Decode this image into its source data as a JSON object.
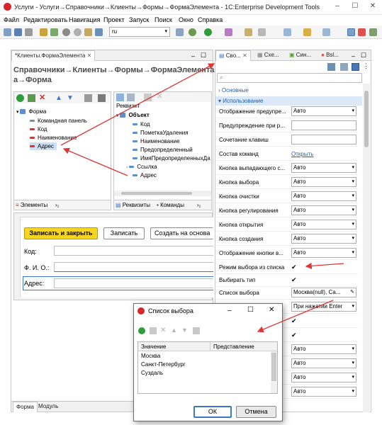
{
  "window": {
    "title": "Услуги - Услуги→Справочники→Клиенты→Формы→ФормаЭлемента - 1C:Enterprise Development Tools"
  },
  "menu": [
    "Файл",
    "Редактировать",
    "Навигация",
    "Проект",
    "Запуск",
    "Поиск",
    "Окно",
    "Справка"
  ],
  "toolbar": {
    "lang": "ru"
  },
  "editor": {
    "tab": "*Клиенты.ФормаЭлемента",
    "heading_line1": "Справочники→Клиенты→Формы→ФормаЭлемента",
    "heading_line2": "а→Форма"
  },
  "elements_tree": {
    "root": "Форма",
    "items": [
      "Командная панель",
      "Код",
      "Наименование",
      "Адрес"
    ],
    "tabs": [
      "Элементы",
      "›₁"
    ]
  },
  "attributes_tree": {
    "header": "Реквизит",
    "root": "Объект",
    "items": [
      "Код",
      "ПометкаУдаления",
      "Наименование",
      "Предопределенный",
      "ИмяПредопределенныхДа",
      "Ссылка",
      "Адрес"
    ],
    "tabs": [
      "Реквизиты",
      "Команды",
      "›₁"
    ]
  },
  "form_preview": {
    "buttons": [
      "Записать и закрыть",
      "Записать",
      "Создать на основа"
    ],
    "fields": [
      "Код:",
      "Ф. И. О.:",
      "Адрес:"
    ]
  },
  "bottom_tabs": [
    "Форма",
    "Модуль"
  ],
  "properties": {
    "tabs": [
      "Сво...",
      "Схе...",
      "Син...",
      "Bsl..."
    ],
    "search_placeholder": "",
    "group_basic": "Основные",
    "group_usage": "Использование",
    "rows": [
      {
        "label": "Отображение предупре...",
        "value": "Авто",
        "type": "select"
      },
      {
        "label": "Предупреждение при р...",
        "value": "",
        "type": "text"
      },
      {
        "label": "Сочетание клавиш",
        "value": "",
        "type": "text"
      },
      {
        "label": "Состав команд",
        "value": "Открыть",
        "type": "link"
      },
      {
        "label": "Кнопка выпадающего с...",
        "value": "Авто",
        "type": "select"
      },
      {
        "label": "Кнопка выбора",
        "value": "Авто",
        "type": "select"
      },
      {
        "label": "Кнопка очистки",
        "value": "Авто",
        "type": "select"
      },
      {
        "label": "Кнопка регулирования",
        "value": "Авто",
        "type": "select"
      },
      {
        "label": "Кнопка открытия",
        "value": "Авто",
        "type": "select"
      },
      {
        "label": "Кнопка создания",
        "value": "Авто",
        "type": "select"
      },
      {
        "label": "Отображение кнопки в...",
        "value": "Авто",
        "type": "select"
      },
      {
        "label": "Режим выбора из списка",
        "value": "✔",
        "type": "check"
      },
      {
        "label": "Выбирать тип",
        "value": "✔",
        "type": "check"
      },
      {
        "label": "Список выбора",
        "value": "Москва(null), Са...",
        "type": "list"
      },
      {
        "label": "",
        "value": "При нажатии Enter",
        "type": "select"
      },
      {
        "label": "",
        "value": "✔",
        "type": "check"
      },
      {
        "label": "",
        "value": "✔",
        "type": "check"
      },
      {
        "label": "",
        "value": "Авто",
        "type": "select"
      },
      {
        "label": "",
        "value": "Авто",
        "type": "select"
      },
      {
        "label": "",
        "value": "Авто",
        "type": "select"
      },
      {
        "label": "",
        "value": "Авто",
        "type": "select"
      }
    ]
  },
  "dialog": {
    "title": "Список выбора",
    "col_value": "Значение",
    "col_presentation": "Представление",
    "rows": [
      "Москва",
      "Санкт-Петербург",
      "Суздаль"
    ],
    "ok": "ОК",
    "cancel": "Отмена"
  }
}
